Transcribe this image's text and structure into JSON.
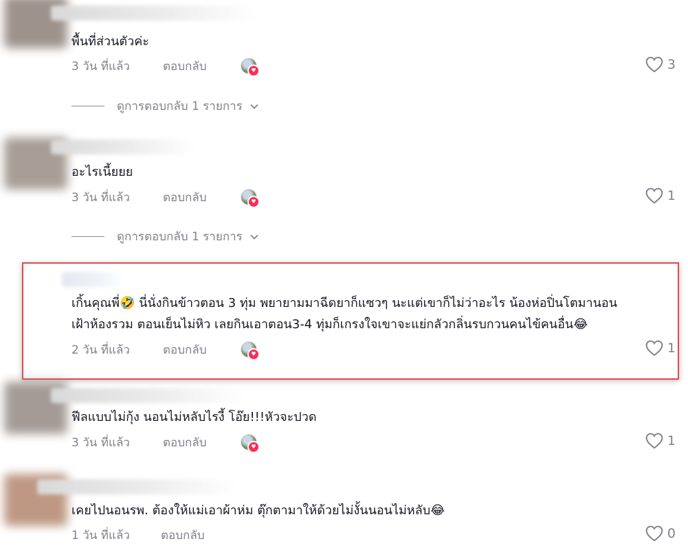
{
  "comments": [
    {
      "text": "พื้นที่ส่วนตัวค่ะ",
      "time": "3 วัน ที่แล้ว",
      "reply_label": "ตอบกลับ",
      "likes": "3",
      "view_replies": "ดูการตอบกลับ 1 รายการ"
    },
    {
      "text": "อะไรเนี้ยยย",
      "time": "3 วัน ที่แล้ว",
      "reply_label": "ตอบกลับ",
      "likes": "1",
      "view_replies": "ดูการตอบกลับ 1 รายการ"
    },
    {
      "text_line1": "เกิ้นคุณพี่🤣 นี่นั่งกินข้าวตอน 3 ทุ่ม พยายามมาฉีดยาก็แซวๆ นะแต่เขาก็ไม่ว่าอะไร น้องห่อปิ่นโตมานอน",
      "text_line2": "เฝ้าห้องรวม ตอนเย็นไม่หิว เลยกินเอาตอน3-4 ทุ่มก็เกรงใจเขาจะแย่กลัวกลิ่นรบกวนคนไข้คนอื่น😂",
      "time": "2 วัน ที่แล้ว",
      "reply_label": "ตอบกลับ",
      "likes": "1"
    },
    {
      "text": "ฟีลแบบไม่กุ้ง นอนไม่หลับไรงี้ โอ๊ย!!!หัวจะปวด",
      "time": "3 วัน ที่แล้ว",
      "reply_label": "ตอบกลับ",
      "likes": "1"
    },
    {
      "text": "เคยไปนอนรพ. ต้องให้แม่เอาผ้าห่ม ตุ๊กตามาให้ด้วยไม่งั้นนอนไม่หลับ😂",
      "time": "1 วัน ที่แล้ว",
      "reply_label": "ตอบกลับ",
      "likes": "0"
    }
  ],
  "icons": {
    "like": "heart-outline-icon",
    "creator_like": "creator-liked-avatar-icon",
    "expand": "chevron-down-icon"
  },
  "colors": {
    "text": "#161823",
    "muted": "#80818a",
    "highlight_border": "#e0484d",
    "badge": "#fe2c55"
  }
}
